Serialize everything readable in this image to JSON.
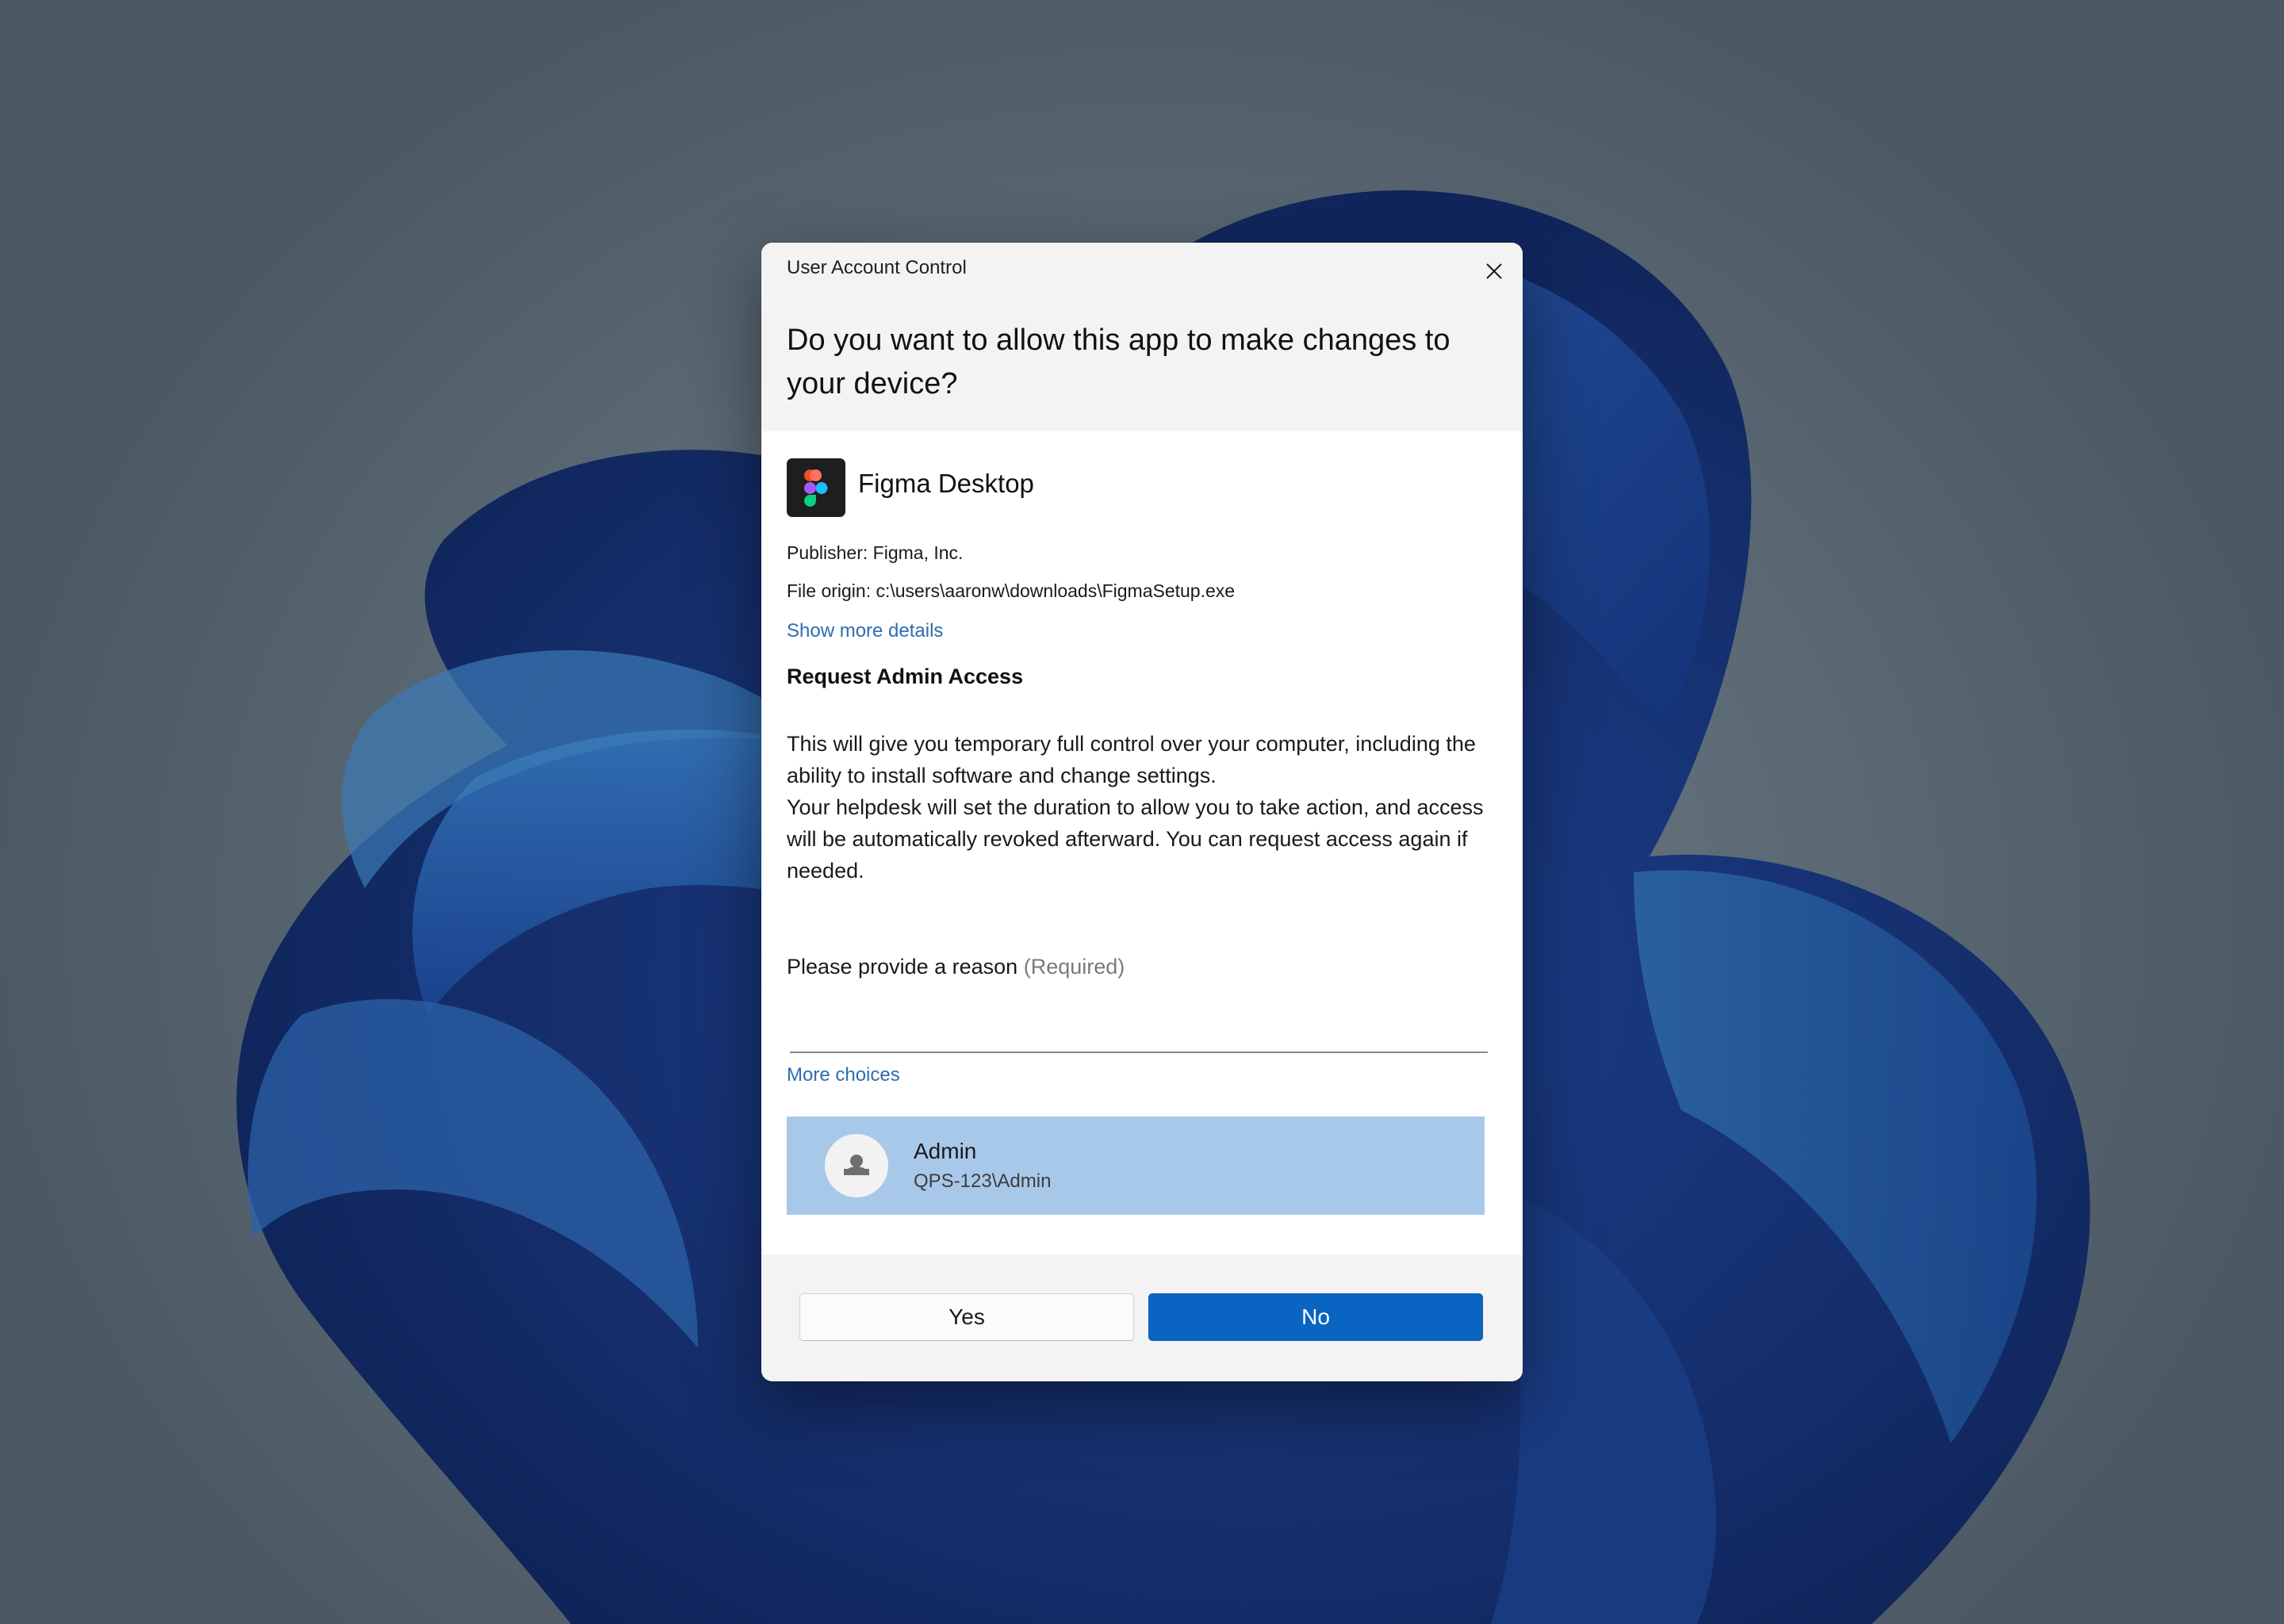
{
  "dialog": {
    "caption": "User Account Control",
    "question": "Do you want to allow this app to make changes to your device?",
    "app_name": "Figma Desktop",
    "publisher": "Publisher: Figma, Inc.",
    "file_origin": "File origin: c:\\users\\aaronw\\downloads\\FigmaSetup.exe",
    "show_more_details": "Show more details",
    "section_title": "Request Admin Access",
    "paragraph_1": "This will give you temporary full control over your computer, including the ability to install software and change settings.",
    "paragraph_2": "Your helpdesk will set the duration to allow you to take action, and access will be automatically revoked afterward. You can request access again if needed.",
    "reason_label": "Please provide a reason",
    "reason_required": "(Required)",
    "reason_value": "",
    "more_choices": "More choices",
    "account": {
      "name": "Admin",
      "domain": "QPS-123\\Admin"
    },
    "buttons": {
      "yes": "Yes",
      "no": "No"
    }
  },
  "icons": {
    "close": "close-icon",
    "app": "figma-logo-icon",
    "avatar": "person-icon"
  },
  "colors": {
    "accent": "#0a64c2",
    "link": "#2f6cb0",
    "account_highlight": "#a8c8ea",
    "header_bg": "#f3f3f3"
  }
}
